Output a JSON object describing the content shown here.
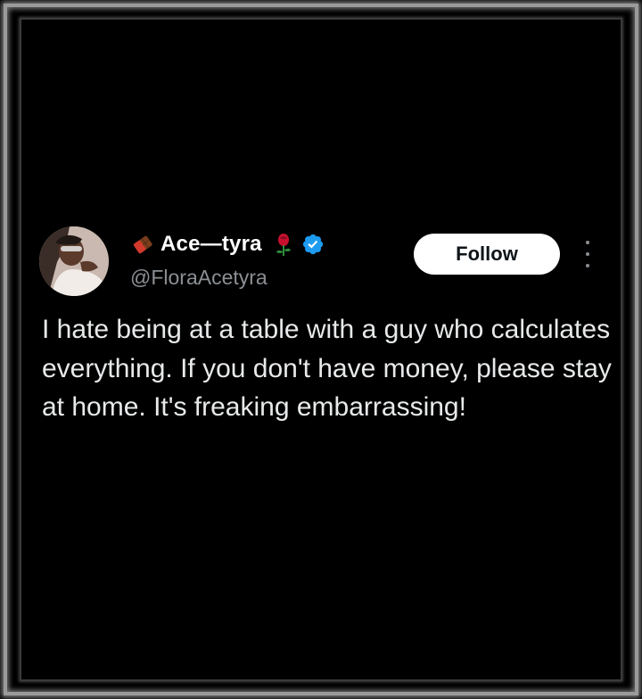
{
  "tweet": {
    "display_name": "Ace—tyra",
    "handle": "@FloraAcetyra",
    "verified_icon": "verified-badge-icon",
    "follow_label": "Follow",
    "text": "I hate being at a table with a guy who calculates everything. If you don't have money, please stay at home. It's freaking embarrassing!"
  },
  "colors": {
    "background": "#000000",
    "verified_badge": "#1d9bf0",
    "handle_gray": "#8b8f93",
    "follow_button_bg": "#ffffff"
  }
}
